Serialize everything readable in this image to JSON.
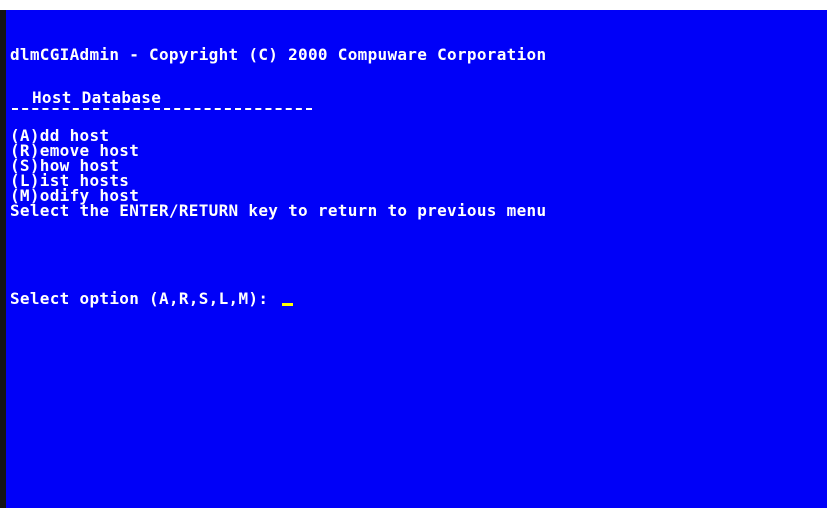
{
  "console": {
    "title": "dlmCGIAdmin - Copyright (C) 2000 Compuware Corporation",
    "section_heading": "Host Database",
    "menu_items": [
      "(A)dd host",
      "(R)emove host",
      "(S)how host",
      "(L)ist hosts",
      "(M)odify host"
    ],
    "return_hint": "Select the ENTER/RETURN key to return to previous menu",
    "prompt": "Select option (A,R,S,L,M): "
  },
  "colors": {
    "background": "#0000f8",
    "text": "#ffffff",
    "cursor": "#ffff00",
    "border": "#141414"
  }
}
